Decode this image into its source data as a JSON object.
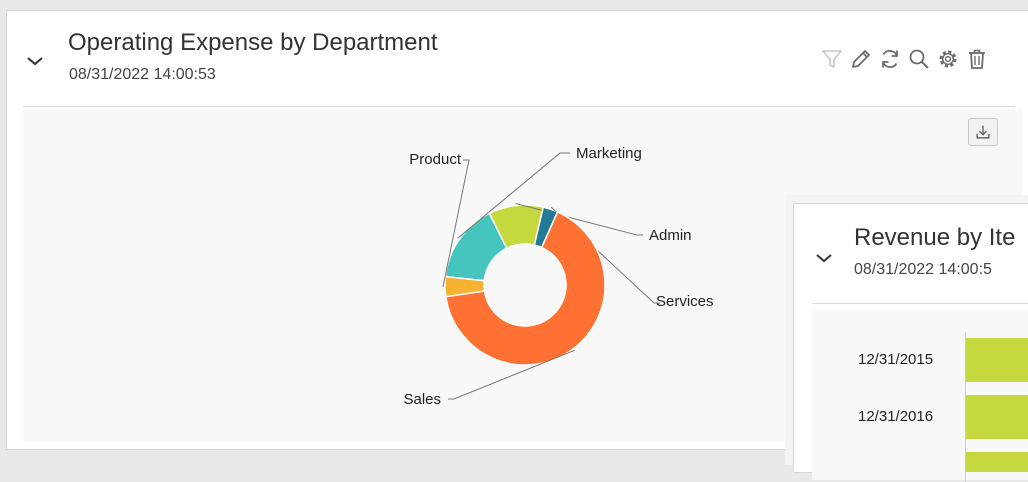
{
  "panel1": {
    "title": "Operating Expense by Department",
    "timestamp": "08/31/2022 14:00:53",
    "toolbar": [
      "filter-icon",
      "pencil-icon",
      "refresh-icon",
      "search-icon",
      "gear-icon",
      "trash-icon"
    ],
    "download_icon": "download-icon"
  },
  "panel2": {
    "title": "Revenue by Ite",
    "timestamp": "08/31/2022 14:00:5"
  },
  "chart_data": [
    {
      "type": "pie",
      "style": "donut",
      "categories": [
        "Marketing",
        "Admin",
        "Services",
        "Sales",
        "Product"
      ],
      "values": [
        16,
        11,
        3,
        66,
        4
      ],
      "colors": [
        "#45c5bd",
        "#c5d83e",
        "#217b96",
        "#ff7033",
        "#f8b231"
      ]
    },
    {
      "type": "bar",
      "orientation": "horizontal",
      "categories": [
        "12/31/2015",
        "12/31/2016"
      ],
      "color": "#c5d83e"
    }
  ]
}
